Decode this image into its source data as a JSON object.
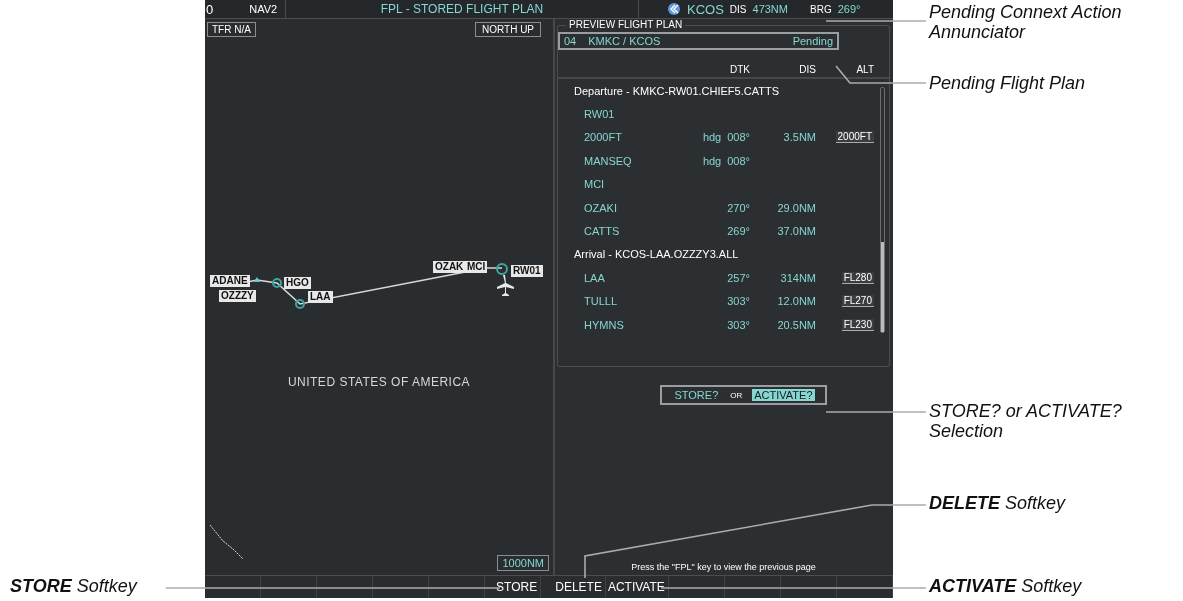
{
  "status_bar": {
    "field_1": "0",
    "nav_source": "NAV2",
    "page_title": "FPL - STORED FLIGHT PLAN",
    "annunciator_waypoint": "KCOS",
    "dis_label": "DIS",
    "dis_value": "473NM",
    "brg_label": "BRG",
    "brg_value": "269°"
  },
  "map": {
    "tfr_status": "TFR N/A",
    "orientation": "NORTH UP",
    "range": "1000NM",
    "country_label": "UNITED STATES OF AMERICA",
    "waypoint_labels": [
      {
        "name": "ADANE"
      },
      {
        "name": "OZZZY"
      },
      {
        "name": "HGO"
      },
      {
        "name": "LAA"
      },
      {
        "name": "OZAK"
      },
      {
        "name": "MCI"
      },
      {
        "name": "RW01"
      }
    ]
  },
  "preview": {
    "title": "PREVIEW FLIGHT PLAN",
    "plan": {
      "number": "04",
      "route": "KMKC / KCOS",
      "status": "Pending"
    },
    "columns": [
      "DTK",
      "DIS",
      "ALT"
    ],
    "rows": [
      {
        "kind": "header",
        "text": "Departure - KMKC-RW01.CHIEF5.CATTS"
      },
      {
        "kind": "leg",
        "name": "RW01"
      },
      {
        "kind": "leg",
        "name": "2000FT",
        "dtk_prefix": "hdg",
        "dtk": "008°",
        "dis": "3.5NM",
        "alt": "2000FT"
      },
      {
        "kind": "leg",
        "name": "MANSEQ",
        "dtk_prefix": "hdg",
        "dtk": "008°"
      },
      {
        "kind": "leg",
        "name": "MCI"
      },
      {
        "kind": "leg",
        "name": "OZAKI",
        "dtk": "270°",
        "dis": "29.0NM"
      },
      {
        "kind": "leg",
        "name": "CATTS",
        "dtk": "269°",
        "dis": "37.0NM"
      },
      {
        "kind": "header",
        "text": "Arrival - KCOS-LAA.OZZZY3.ALL"
      },
      {
        "kind": "leg",
        "name": "LAA",
        "dtk": "257°",
        "dis": "314NM",
        "alt": "FL280"
      },
      {
        "kind": "leg",
        "name": "TULLL",
        "dtk": "303°",
        "dis": "12.0NM",
        "alt": "FL270"
      },
      {
        "kind": "leg",
        "name": "HYMNS",
        "dtk": "303°",
        "dis": "20.5NM",
        "alt": "FL230"
      }
    ],
    "prompt": {
      "options": [
        {
          "label": "STORE?",
          "selected": false
        },
        {
          "label": "ACTIVATE?",
          "selected": true
        }
      ],
      "connector": "OR"
    },
    "message": "Press the \"FPL\" key to view the previous page"
  },
  "softkeys": [
    {
      "label": "STORE"
    },
    {
      "label": "DELETE"
    },
    {
      "label": "ACTIVATE"
    }
  ],
  "callouts": [
    {
      "text": "Pending Connext Action Annunciator"
    },
    {
      "text": "Pending Flight Plan"
    },
    {
      "text": "STORE? or ACTIVATE? Selection"
    },
    {
      "text": "**DELETE** Softkey"
    },
    {
      "text": "**STORE** Softkey"
    },
    {
      "text": "**ACTIVATE** Softkey"
    }
  ]
}
